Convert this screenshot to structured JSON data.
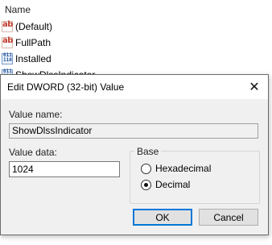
{
  "list": {
    "header": "Name",
    "rows": [
      {
        "label": "(Default)",
        "icon": "string-value-icon"
      },
      {
        "label": "FullPath",
        "icon": "string-value-icon"
      },
      {
        "label": "Installed",
        "icon": "binary-value-icon"
      },
      {
        "label": "ShowDlssIndicator",
        "icon": "binary-value-icon"
      }
    ]
  },
  "dialog": {
    "title": "Edit DWORD (32-bit) Value",
    "close_glyph": "✕",
    "value_name_label": "Value name:",
    "value_name": "ShowDlssIndicator",
    "value_data_label": "Value data:",
    "value_data": "1024",
    "base_label": "Base",
    "base_options": [
      "Hexadecimal",
      "Decimal"
    ],
    "base_selected": "Decimal",
    "ok_label": "OK",
    "cancel_label": "Cancel"
  },
  "colors": {
    "accent": "#0078d7",
    "dialog_body": "#f0f0f0"
  }
}
